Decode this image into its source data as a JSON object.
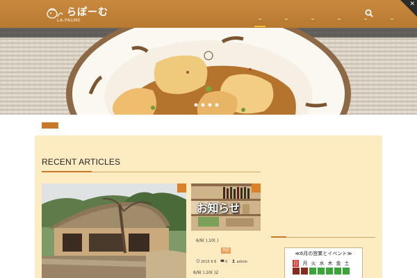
{
  "header": {
    "logo_text": "らぽーむ",
    "logo_sub": "LA-PAUME",
    "nav_items": [
      "",
      "",
      "",
      "",
      "",
      ""
    ],
    "search_icon": "search-icon",
    "corner_icon": "close-icon"
  },
  "main": {
    "recent_title": "RECENT ARTICLES",
    "card2_title": "お知らせ",
    "post_title": "6/9( ),10( )",
    "post_category": "日記",
    "post_date": "2015 6 8",
    "post_comments": "0",
    "post_author": "admin",
    "post_title2": "6/9( ),10( )2"
  },
  "sidebar": {
    "calendar_title": "≪6月の営業とイベント≫",
    "weekdays": [
      "日",
      "月",
      "火",
      "水",
      "木",
      "金",
      "土"
    ]
  },
  "colors": {
    "header": "#c98a3f",
    "accent": "#c6772a",
    "content_bg": "#fdecc1",
    "calendar_sunday": "#d8322e",
    "calendar_open": "#3aa63a",
    "calendar_closed": "#8a2a1a"
  }
}
